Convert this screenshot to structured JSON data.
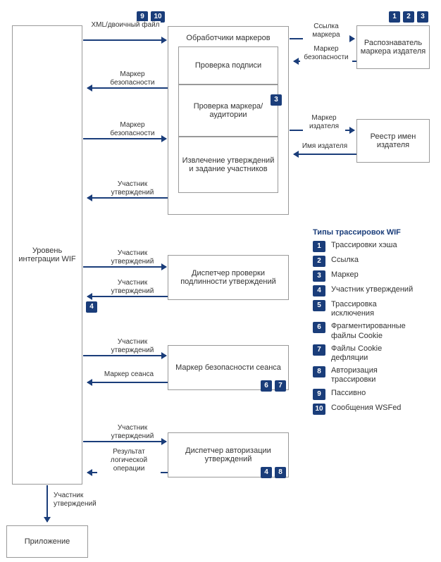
{
  "boxes": {
    "wif": "Уровень интеграции WIF",
    "handlers": "Обработчики маркеров",
    "sig": "Проверка подписи",
    "tokaud": "Проверка маркера/аудитории",
    "extract": "Извлечение утверждений и задание участников",
    "recognizer": "Распознаватель маркера издателя",
    "registry": "Реестр имен издателя",
    "auth": "Диспетчер проверки подлинности утверждений",
    "session": "Маркер безопасности сеанса",
    "authz": "Диспетчер авторизации утверждений",
    "app": "Приложение"
  },
  "arrows": {
    "xmlbin": "XML/двоичный файл",
    "markref": "Ссылка маркера",
    "secmark": "Маркер безопасности",
    "pubmark": "Маркер издателя",
    "pubname": "Имя издателя",
    "claimsprin": "Участник утверждений",
    "sessmark": "Маркер сеанса",
    "logicres": "Результат логической операции"
  },
  "legend": {
    "title": "Типы трассировок WIF",
    "items": [
      {
        "n": "1",
        "t": "Трассировки хэша"
      },
      {
        "n": "2",
        "t": "Ссылка"
      },
      {
        "n": "3",
        "t": "Маркер"
      },
      {
        "n": "4",
        "t": "Участник утверждений"
      },
      {
        "n": "5",
        "t": "Трассировка исключения"
      },
      {
        "n": "6",
        "t": "Фрагментированные файлы Cookie"
      },
      {
        "n": "7",
        "t": "Файлы Cookie дефляции"
      },
      {
        "n": "8",
        "t": "Авторизация трассировки"
      },
      {
        "n": "9",
        "t": "Пассивно"
      },
      {
        "n": "10",
        "t": "Сообщения WSFed"
      }
    ]
  },
  "badges": {
    "b1": "1",
    "b2": "2",
    "b3": "3",
    "b4": "4",
    "b6": "6",
    "b7": "7",
    "b8": "8",
    "b9": "9",
    "b10": "10"
  }
}
